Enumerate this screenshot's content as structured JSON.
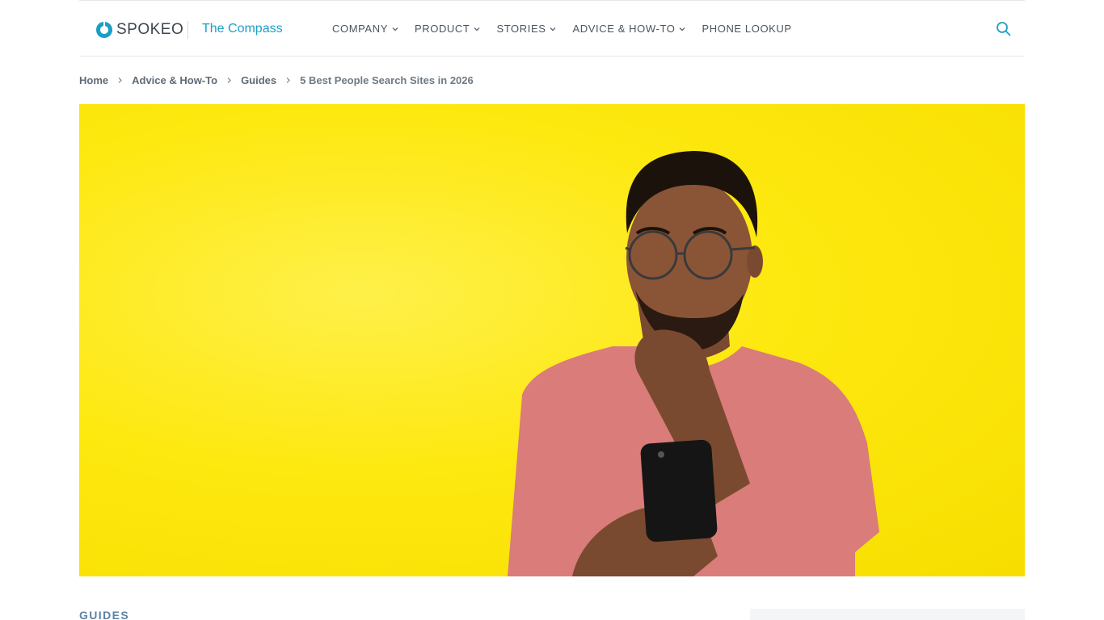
{
  "header": {
    "logo_text": "SPOKEO",
    "subtitle": "The Compass",
    "nav": [
      {
        "label": "COMPANY",
        "has_dropdown": true
      },
      {
        "label": "PRODUCT",
        "has_dropdown": true
      },
      {
        "label": "STORIES",
        "has_dropdown": true
      },
      {
        "label": "ADVICE & HOW-TO",
        "has_dropdown": true
      },
      {
        "label": "PHONE LOOKUP",
        "has_dropdown": false
      }
    ],
    "search_icon": "search-icon"
  },
  "breadcrumb": {
    "items": [
      "Home",
      "Advice & How-To",
      "Guides"
    ],
    "current": "5 Best People Search Sites in 2026"
  },
  "hero": {
    "icon": "photo",
    "background_color": "#fde80f"
  },
  "article": {
    "category": "GUIDES"
  },
  "colors": {
    "brand": "#1a9fc6",
    "text": "#4a5560",
    "category": "#5d83a6"
  }
}
